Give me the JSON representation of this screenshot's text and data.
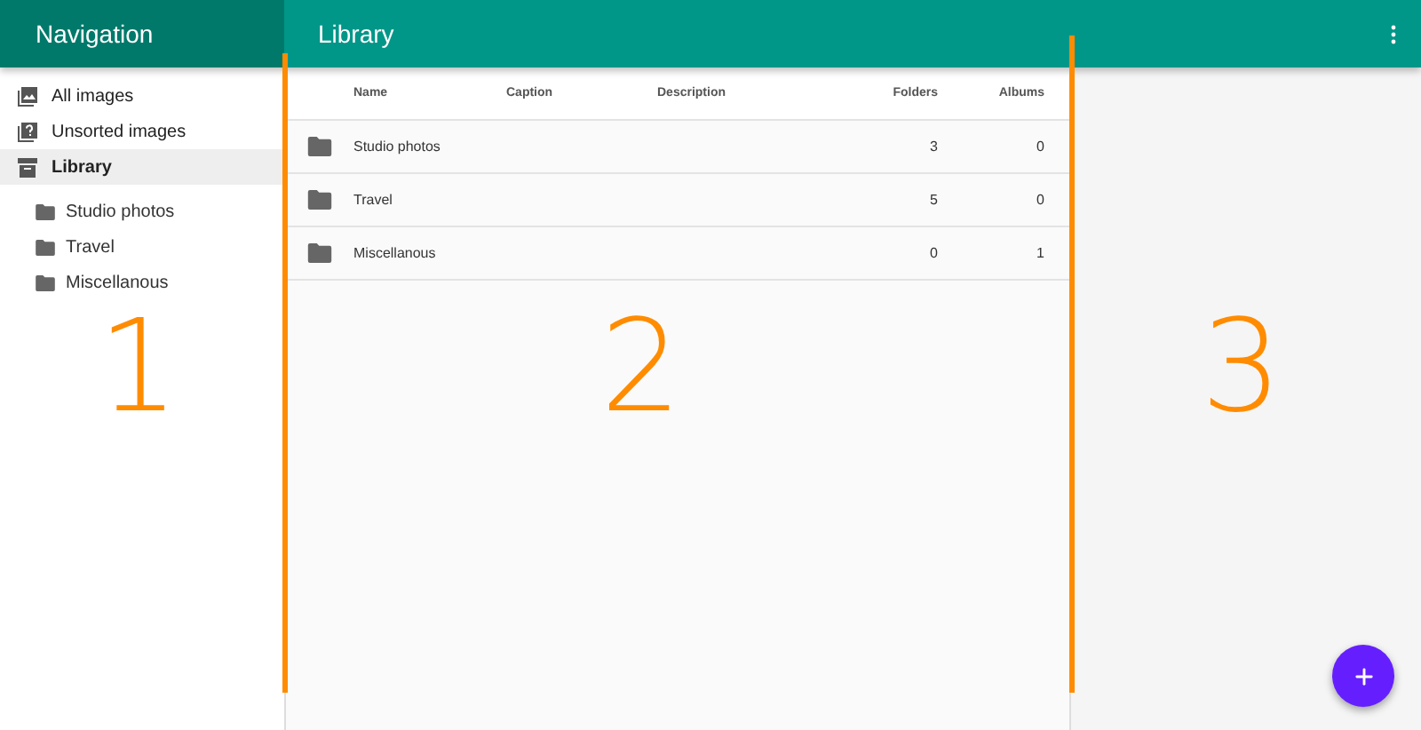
{
  "navigation": {
    "title": "Navigation",
    "items": [
      {
        "label": "All images",
        "kind": "images",
        "selected": false
      },
      {
        "label": "Unsorted images",
        "kind": "unsorted",
        "selected": false
      },
      {
        "label": "Library",
        "kind": "library",
        "selected": true,
        "children": [
          {
            "label": "Studio photos"
          },
          {
            "label": "Travel"
          },
          {
            "label": "Miscellanous"
          }
        ]
      }
    ]
  },
  "main": {
    "title": "Library"
  },
  "table": {
    "columns": [
      "Name",
      "Caption",
      "Description",
      "Folders",
      "Albums"
    ],
    "rows": [
      {
        "name": "Studio photos",
        "folders": "3",
        "albums": "0"
      },
      {
        "name": "Travel",
        "folders": "5",
        "albums": "0"
      },
      {
        "name": "Miscellanous",
        "folders": "0",
        "albums": "1"
      }
    ]
  },
  "annotations": [
    {
      "label": "1"
    },
    {
      "label": "2"
    },
    {
      "label": "3"
    }
  ]
}
